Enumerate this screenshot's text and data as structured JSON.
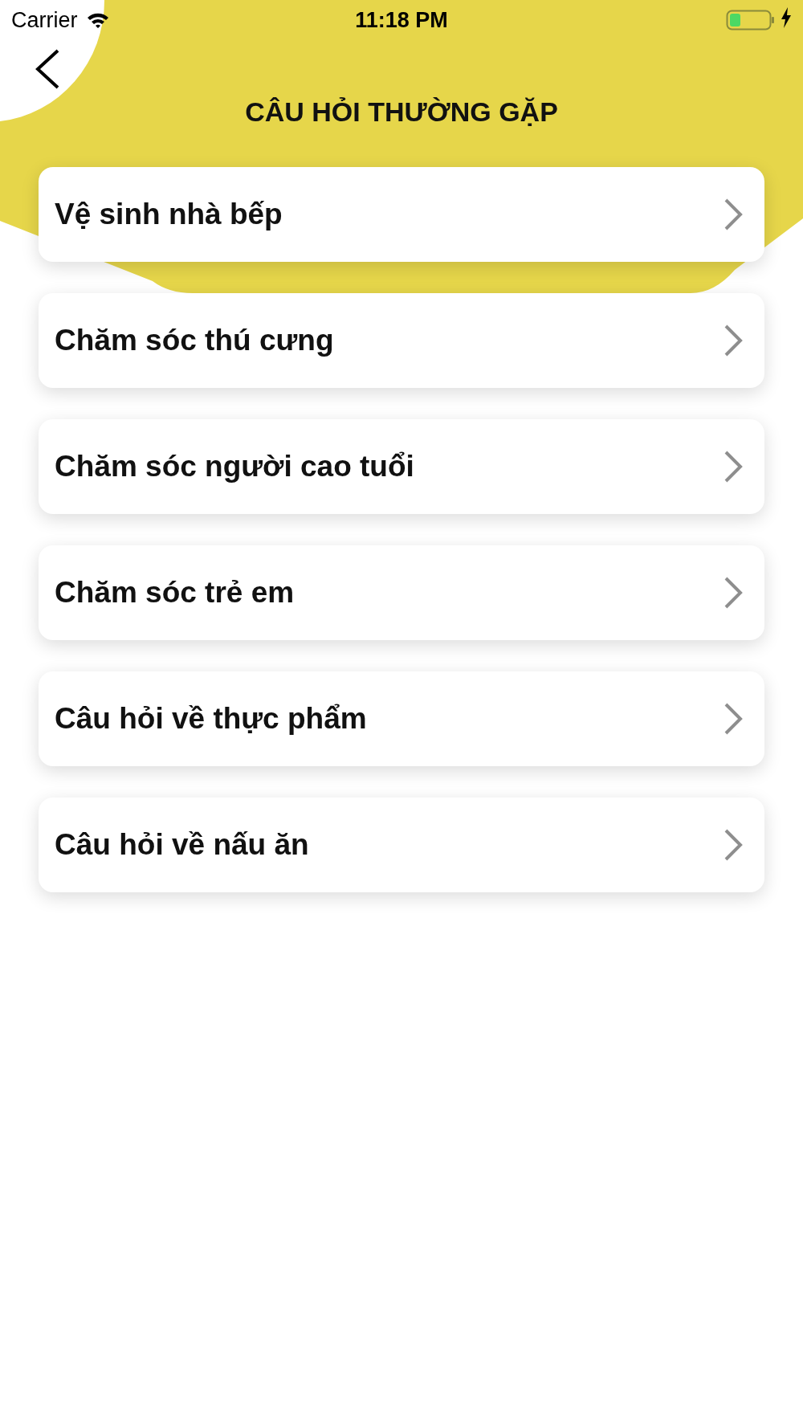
{
  "status_bar": {
    "carrier": "Carrier",
    "time": "11:18 PM",
    "charging": true
  },
  "header": {
    "title": "CÂU HỎI THƯỜNG GẶP"
  },
  "topics": [
    {
      "label": "Vệ sinh nhà bếp"
    },
    {
      "label": "Chăm sóc thú cưng"
    },
    {
      "label": "Chăm sóc người cao tuổi"
    },
    {
      "label": "Chăm sóc trẻ em"
    },
    {
      "label": "Câu hỏi về thực phẩm"
    },
    {
      "label": "Câu hỏi về nấu ăn"
    }
  ]
}
